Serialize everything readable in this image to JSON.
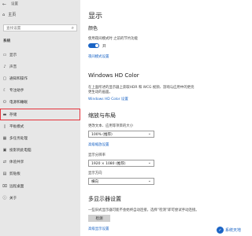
{
  "window": {
    "title": "设置"
  },
  "sidebar": {
    "home_label": "主页",
    "search_placeholder": "查找设置",
    "section_label": "系统",
    "items": [
      {
        "label": "显示",
        "icon": "monitor-icon"
      },
      {
        "label": "声音",
        "icon": "speaker-icon"
      },
      {
        "label": "通知和操作",
        "icon": "notification-icon"
      },
      {
        "label": "专注助手",
        "icon": "moon-icon"
      },
      {
        "label": "电源和睡眠",
        "icon": "power-icon"
      },
      {
        "label": "存储",
        "icon": "storage-icon",
        "selected": true
      },
      {
        "label": "平板模式",
        "icon": "tablet-icon"
      },
      {
        "label": "多任务处理",
        "icon": "multitask-icon"
      },
      {
        "label": "投影到此电脑",
        "icon": "project-icon"
      },
      {
        "label": "体验共享",
        "icon": "share-icon"
      },
      {
        "label": "剪贴板",
        "icon": "clipboard-icon"
      },
      {
        "label": "远程桌面",
        "icon": "remote-desktop-icon"
      },
      {
        "label": "关于",
        "icon": "info-icon"
      }
    ]
  },
  "main": {
    "title": "显示",
    "color": {
      "heading": "颜色",
      "night_light_label": "使用夜间模式时 之前的节约功能",
      "toggle_label": "开",
      "link": "夜间模式设置"
    },
    "hd": {
      "heading": "Windows HD Color",
      "desc_line1": "在上面所述的显示器上获取HDR 和 WCG 视频、游戏与应用中的更亮",
      "desc_line2": "更生动的画面。",
      "link": "Windows HD Color 设置"
    },
    "scale": {
      "heading": "缩放与布局",
      "label1": "更改文本、应用等项目的大小",
      "value1": "100% (推荐)",
      "link": "高级缩放设置",
      "label2": "显示分辨率",
      "value2": "1920 × 1080 (推荐)",
      "label3": "显示方向",
      "value3": "横向"
    },
    "multi": {
      "heading": "多显示器设置",
      "desc": "一些旧式显示器可能不会始终自动连接，选择“检测”即可尝试手动连接。",
      "button": "检测",
      "link": "高级显示设置"
    }
  },
  "watermark": {
    "text": "系统天地"
  },
  "colors": {
    "accent": "#1a64c5",
    "sidebar_bg": "#e7e7e7",
    "highlight": "#e5323b"
  }
}
